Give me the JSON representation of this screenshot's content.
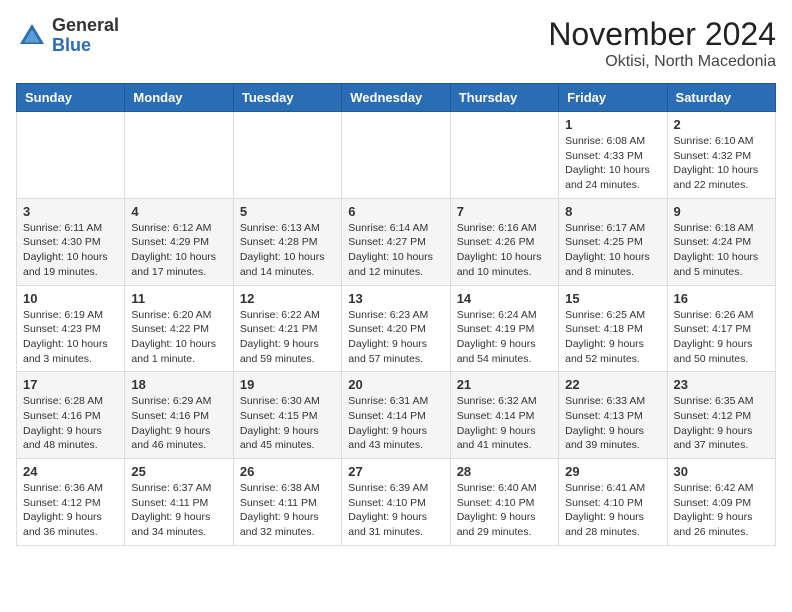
{
  "logo": {
    "general": "General",
    "blue": "Blue"
  },
  "title": "November 2024",
  "subtitle": "Oktisi, North Macedonia",
  "days_of_week": [
    "Sunday",
    "Monday",
    "Tuesday",
    "Wednesday",
    "Thursday",
    "Friday",
    "Saturday"
  ],
  "weeks": [
    [
      {
        "day": "",
        "info": ""
      },
      {
        "day": "",
        "info": ""
      },
      {
        "day": "",
        "info": ""
      },
      {
        "day": "",
        "info": ""
      },
      {
        "day": "",
        "info": ""
      },
      {
        "day": "1",
        "info": "Sunrise: 6:08 AM\nSunset: 4:33 PM\nDaylight: 10 hours and 24 minutes."
      },
      {
        "day": "2",
        "info": "Sunrise: 6:10 AM\nSunset: 4:32 PM\nDaylight: 10 hours and 22 minutes."
      }
    ],
    [
      {
        "day": "3",
        "info": "Sunrise: 6:11 AM\nSunset: 4:30 PM\nDaylight: 10 hours and 19 minutes."
      },
      {
        "day": "4",
        "info": "Sunrise: 6:12 AM\nSunset: 4:29 PM\nDaylight: 10 hours and 17 minutes."
      },
      {
        "day": "5",
        "info": "Sunrise: 6:13 AM\nSunset: 4:28 PM\nDaylight: 10 hours and 14 minutes."
      },
      {
        "day": "6",
        "info": "Sunrise: 6:14 AM\nSunset: 4:27 PM\nDaylight: 10 hours and 12 minutes."
      },
      {
        "day": "7",
        "info": "Sunrise: 6:16 AM\nSunset: 4:26 PM\nDaylight: 10 hours and 10 minutes."
      },
      {
        "day": "8",
        "info": "Sunrise: 6:17 AM\nSunset: 4:25 PM\nDaylight: 10 hours and 8 minutes."
      },
      {
        "day": "9",
        "info": "Sunrise: 6:18 AM\nSunset: 4:24 PM\nDaylight: 10 hours and 5 minutes."
      }
    ],
    [
      {
        "day": "10",
        "info": "Sunrise: 6:19 AM\nSunset: 4:23 PM\nDaylight: 10 hours and 3 minutes."
      },
      {
        "day": "11",
        "info": "Sunrise: 6:20 AM\nSunset: 4:22 PM\nDaylight: 10 hours and 1 minute."
      },
      {
        "day": "12",
        "info": "Sunrise: 6:22 AM\nSunset: 4:21 PM\nDaylight: 9 hours and 59 minutes."
      },
      {
        "day": "13",
        "info": "Sunrise: 6:23 AM\nSunset: 4:20 PM\nDaylight: 9 hours and 57 minutes."
      },
      {
        "day": "14",
        "info": "Sunrise: 6:24 AM\nSunset: 4:19 PM\nDaylight: 9 hours and 54 minutes."
      },
      {
        "day": "15",
        "info": "Sunrise: 6:25 AM\nSunset: 4:18 PM\nDaylight: 9 hours and 52 minutes."
      },
      {
        "day": "16",
        "info": "Sunrise: 6:26 AM\nSunset: 4:17 PM\nDaylight: 9 hours and 50 minutes."
      }
    ],
    [
      {
        "day": "17",
        "info": "Sunrise: 6:28 AM\nSunset: 4:16 PM\nDaylight: 9 hours and 48 minutes."
      },
      {
        "day": "18",
        "info": "Sunrise: 6:29 AM\nSunset: 4:16 PM\nDaylight: 9 hours and 46 minutes."
      },
      {
        "day": "19",
        "info": "Sunrise: 6:30 AM\nSunset: 4:15 PM\nDaylight: 9 hours and 45 minutes."
      },
      {
        "day": "20",
        "info": "Sunrise: 6:31 AM\nSunset: 4:14 PM\nDaylight: 9 hours and 43 minutes."
      },
      {
        "day": "21",
        "info": "Sunrise: 6:32 AM\nSunset: 4:14 PM\nDaylight: 9 hours and 41 minutes."
      },
      {
        "day": "22",
        "info": "Sunrise: 6:33 AM\nSunset: 4:13 PM\nDaylight: 9 hours and 39 minutes."
      },
      {
        "day": "23",
        "info": "Sunrise: 6:35 AM\nSunset: 4:12 PM\nDaylight: 9 hours and 37 minutes."
      }
    ],
    [
      {
        "day": "24",
        "info": "Sunrise: 6:36 AM\nSunset: 4:12 PM\nDaylight: 9 hours and 36 minutes."
      },
      {
        "day": "25",
        "info": "Sunrise: 6:37 AM\nSunset: 4:11 PM\nDaylight: 9 hours and 34 minutes."
      },
      {
        "day": "26",
        "info": "Sunrise: 6:38 AM\nSunset: 4:11 PM\nDaylight: 9 hours and 32 minutes."
      },
      {
        "day": "27",
        "info": "Sunrise: 6:39 AM\nSunset: 4:10 PM\nDaylight: 9 hours and 31 minutes."
      },
      {
        "day": "28",
        "info": "Sunrise: 6:40 AM\nSunset: 4:10 PM\nDaylight: 9 hours and 29 minutes."
      },
      {
        "day": "29",
        "info": "Sunrise: 6:41 AM\nSunset: 4:10 PM\nDaylight: 9 hours and 28 minutes."
      },
      {
        "day": "30",
        "info": "Sunrise: 6:42 AM\nSunset: 4:09 PM\nDaylight: 9 hours and 26 minutes."
      }
    ]
  ]
}
